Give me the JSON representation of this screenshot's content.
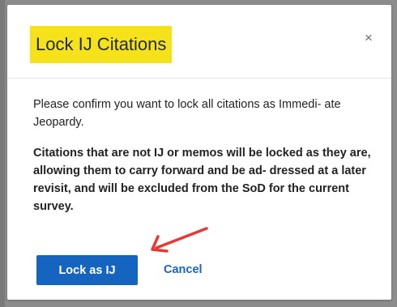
{
  "dialog": {
    "title": "Lock IJ Citations",
    "close_symbol": "×",
    "message": "Please confirm you want to lock all citations as Immedi- ate Jeopardy.",
    "warning": "Citations that are not IJ or memos will be locked as they are, allowing them to carry forward and be ad- dressed at a later revisit, and will be excluded from the SoD for the current survey.",
    "primary_button_label": "Lock as IJ",
    "cancel_label": "Cancel"
  },
  "colors": {
    "accent": "#1565c0",
    "highlight": "#f6e21a",
    "annotation_arrow": "#e53935"
  },
  "icons": {
    "close": "close-icon",
    "annotation": "red-arrow-icon"
  }
}
